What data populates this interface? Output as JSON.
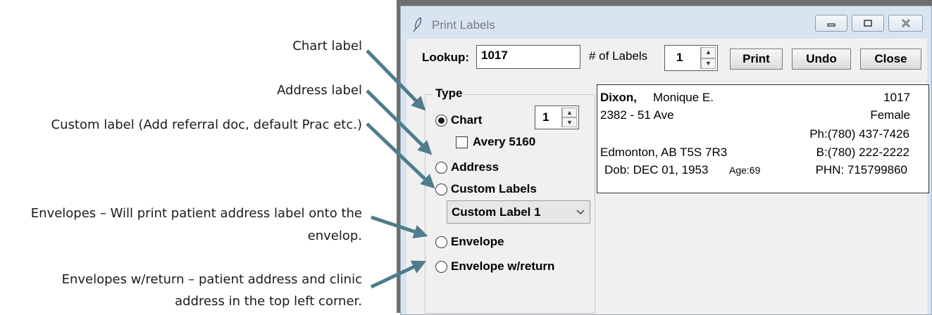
{
  "annotations": {
    "chart": "Chart label",
    "address": "Address label",
    "custom": "Custom label (Add referral doc, default Prac etc.)",
    "envelope_line1": "Envelopes – Will print patient address label onto the",
    "envelope_line2": "envelop.",
    "return_line1": "Envelopes w/return – patient address and clinic",
    "return_line2": "address in the top left corner.",
    "arrow_color": "#4f7d8c"
  },
  "window": {
    "title": "Print Labels",
    "icon": "feather-icon",
    "controls": [
      "minimize-icon",
      "maximize-icon",
      "close-icon"
    ]
  },
  "toolbar": {
    "lookup_label": "Lookup:",
    "lookup_value": "1017",
    "num_labels_label": "# of Labels",
    "num_labels_value": "1",
    "print": "Print",
    "undo": "Undo",
    "close": "Close"
  },
  "type_group": {
    "title": "Type",
    "chart": "Chart",
    "chart_count": "1",
    "avery": "Avery 5160",
    "address": "Address",
    "custom_labels": "Custom Labels",
    "custom_select": "Custom Label 1",
    "envelope": "Envelope",
    "envelope_return": "Envelope w/return",
    "selected": "Chart"
  },
  "patient": {
    "last_name": "Dixon,",
    "first_name": "Monique E.",
    "id": "1017",
    "address": "2382 - 51 Ave",
    "gender": "Female",
    "phone": "Ph:(780) 437-7426",
    "city": "Edmonton, AB  T5S 7R3",
    "business": "B:(780) 222-2222",
    "dob": "Dob: DEC 01, 1953",
    "age": "Age:69",
    "phn": "PHN: 715799860"
  }
}
